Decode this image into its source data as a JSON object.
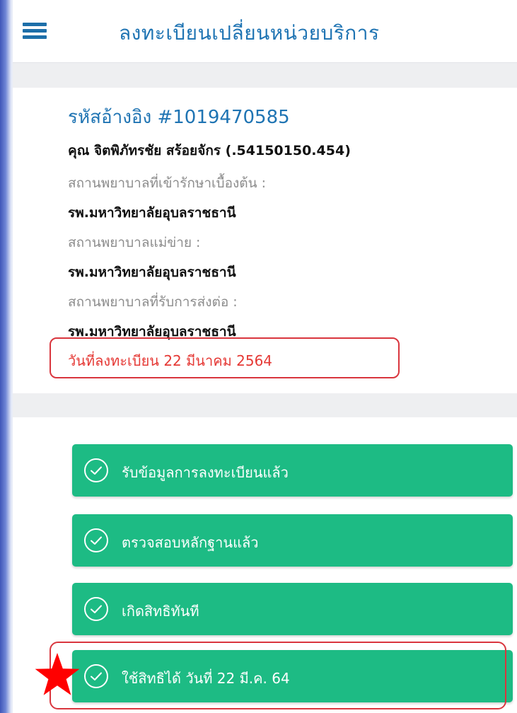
{
  "header": {
    "title": "ลงทะเบียนเปลี่ยนหน่วยบริการ",
    "menu_icon": "hamburger-menu-icon"
  },
  "info": {
    "reference": "รหัสอ้างอิง #1019470585",
    "name": "คุณ จิตพิภัทรชัย สร้อยจักร (.54150150.454)",
    "primary_hospital_label": "สถานพยาบาลที่เข้ารักษาเบื้องต้น :",
    "primary_hospital": "รพ.มหาวิทยาลัยอุบลราชธานี",
    "main_hospital_label": "สถานพยาบาลแม่ข่าย :",
    "main_hospital": "รพ.มหาวิทยาลัยอุบลราชธานี",
    "referral_hospital_label": "สถานพยาบาลที่รับการส่งต่อ :",
    "referral_hospital": "รพ.มหาวิทยาลัยอุบลราชธานี",
    "registration_date": "วันที่ลงทะเบียน 22 มีนาคม 2564"
  },
  "steps": [
    {
      "label": "รับข้อมูลการลงทะเบียนแล้ว",
      "icon": "check-circle-icon"
    },
    {
      "label": "ตรวจสอบหลักฐานแล้ว",
      "icon": "check-circle-icon"
    },
    {
      "label": "เกิดสิทธิทันที",
      "icon": "check-circle-icon"
    },
    {
      "label": "ใช้สิทธิได้ วันที่ 22 มี.ค. 64",
      "icon": "check-circle-icon"
    }
  ],
  "colors": {
    "accent_blue": "#1f74b3",
    "step_green": "#1dbb84",
    "highlight_red": "#d9363e",
    "date_red": "#e53935",
    "star_red": "#ff0000"
  }
}
